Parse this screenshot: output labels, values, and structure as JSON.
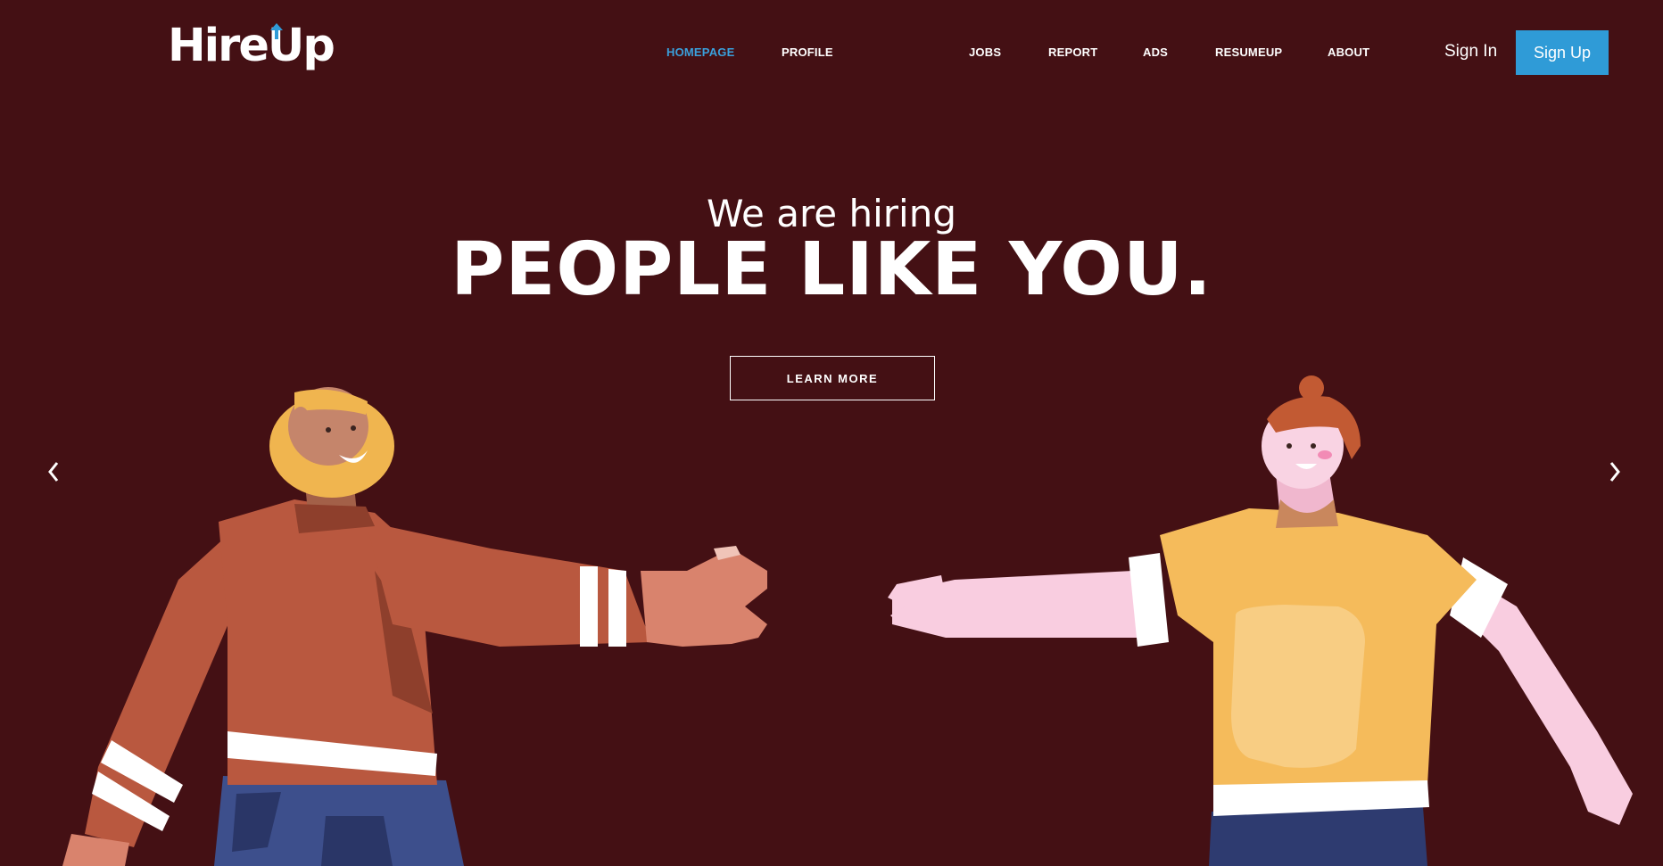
{
  "brand": {
    "logo_text_a": "Hire",
    "logo_text_b": "Up"
  },
  "nav": {
    "items": [
      {
        "label": "HOMEPAGE",
        "active": true
      },
      {
        "label": "PROFILE"
      },
      {
        "label": "JOBS"
      },
      {
        "label": "REPORT"
      },
      {
        "label": "ADS"
      },
      {
        "label": "RESUMEUP"
      },
      {
        "label": "ABOUT"
      }
    ],
    "sign_in": "Sign In",
    "sign_up": "Sign Up"
  },
  "hero": {
    "subtitle": "We are hiring",
    "title": "PEOPLE LIKE YOU.",
    "cta": "LEARN MORE"
  },
  "carousel": {
    "prev_icon": "chevron-left-icon",
    "next_icon": "chevron-right-icon"
  },
  "colors": {
    "background": "#441014",
    "accent": "#3aa0dc",
    "button": "#2f9bd7"
  }
}
